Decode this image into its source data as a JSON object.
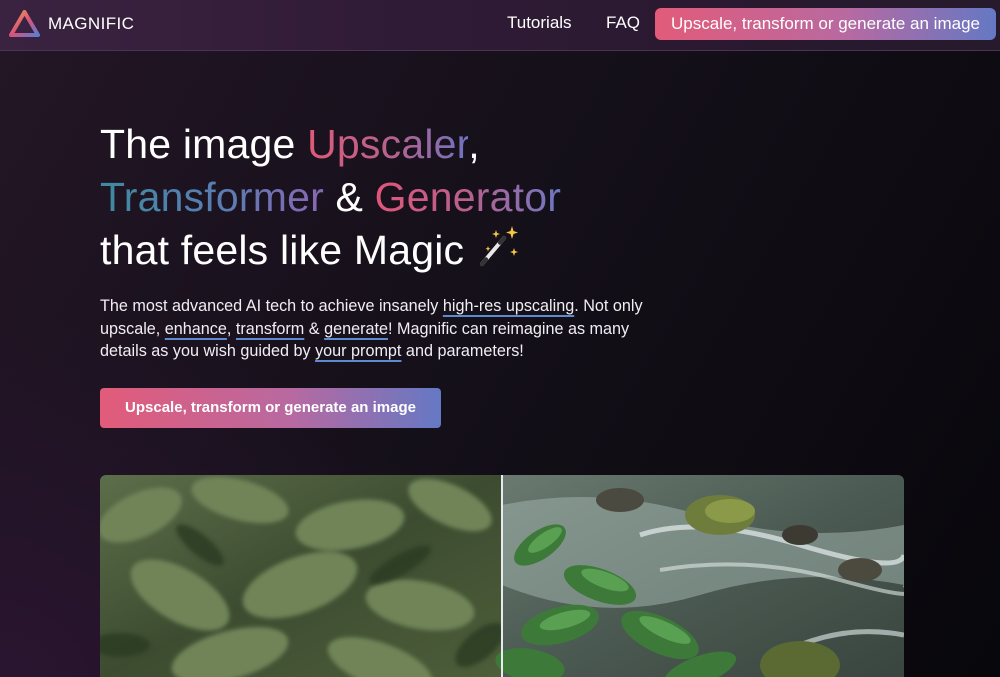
{
  "nav": {
    "brand": "MAGNIFIC",
    "links": [
      "Tutorials",
      "FAQ"
    ],
    "cta": "Upscale, transform or generate an image"
  },
  "hero": {
    "title": {
      "the_image": "The image ",
      "upscaler": "Upscaler",
      "comma": ",",
      "transformer": "Transformer",
      "amp": " & ",
      "generator": "Generator",
      "line3": "that feels like Magic"
    },
    "description": {
      "p1": "The most advanced AI tech to achieve insanely ",
      "link_high_res": "high-res upscaling",
      "p2": ". Not only upscale, ",
      "link_enhance": "enhance",
      "p3": ", ",
      "link_transform": "transform",
      "p4": " & ",
      "link_generate": "generate",
      "p5": "! Magnific can reimagine as many details as you wish guided by ",
      "link_prompt": "your prompt",
      "p6": " and parameters!"
    },
    "cta": "Upscale, transform or generate an image"
  },
  "icons": {
    "logo": "triangle-logo-icon",
    "wand": "magic-wand-icon"
  },
  "colors": {
    "accent_pink": "#e25b79",
    "accent_blue": "#6578c4",
    "underline": "#5f8ad0"
  }
}
